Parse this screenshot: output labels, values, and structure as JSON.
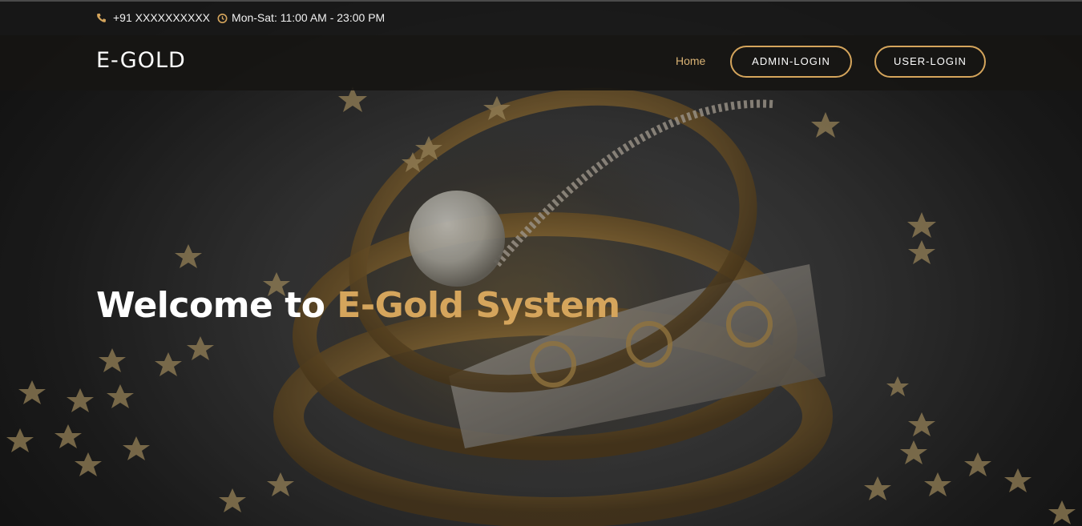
{
  "topbar": {
    "phone_icon": "phone-icon",
    "phone": "+91 XXXXXXXXXX",
    "clock_icon": "clock-icon",
    "hours": "Mon-Sat: 11:00 AM - 23:00 PM"
  },
  "navbar": {
    "logo": "E-GOLD",
    "home_label": "Home",
    "admin_login_label": "ADMIN-LOGIN",
    "user_login_label": "USER-LOGIN"
  },
  "hero": {
    "welcome_prefix": "Welcome to ",
    "welcome_highlight": "E-Gold System",
    "background_image": "gold-jewelry-bangles-photo"
  },
  "colors": {
    "accent": "#d5a55c",
    "accent_light": "#d9b274",
    "bar_bg": "#161513",
    "text": "#ffffff"
  }
}
